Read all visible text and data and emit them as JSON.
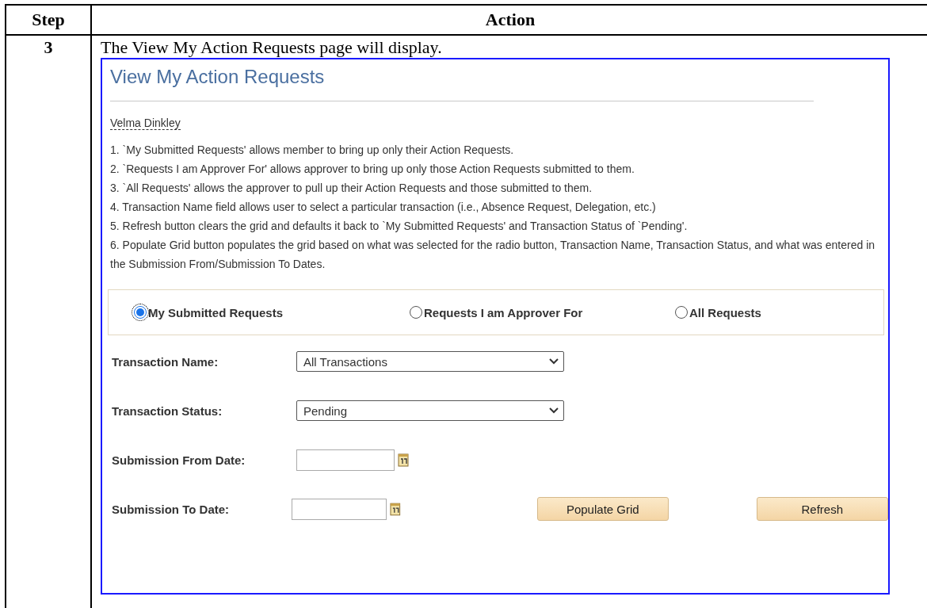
{
  "table": {
    "columns": [
      "Step",
      "Action"
    ],
    "rows": [
      {
        "step": "3",
        "instruction": "The View My Action Requests page will display.",
        "screenshot": {
          "title": "View My Action Requests",
          "user_name": "Velma Dinkley",
          "notes": [
            "1. `My Submitted Requests' allows member to bring up only their Action Requests.",
            "2. `Requests I am Approver For' allows approver to bring up only those Action Requests submitted to them.",
            "3. `All Requests' allows the approver to pull up their Action Requests and those submitted to them.",
            "4. Transaction Name field allows user to select a particular transaction (i.e., Absence Request, Delegation, etc.)",
            "5. Refresh button clears the grid and defaults it back to `My Submitted Requests' and Transaction Status of `Pending'.",
            "6. Populate Grid button populates the grid based on what was selected for the radio button, Transaction Name, Transaction Status, and what was entered in the Submission From/Submission To Dates."
          ],
          "radios": [
            {
              "label": "My Submitted Requests",
              "selected": true
            },
            {
              "label": "Requests I am Approver For",
              "selected": false
            },
            {
              "label": "All Requests",
              "selected": false
            }
          ],
          "fields": [
            {
              "kind": "select",
              "label": "Transaction Name:",
              "value": "All Transactions"
            },
            {
              "kind": "select",
              "label": "Transaction Status:",
              "value": "Pending"
            },
            {
              "kind": "date",
              "label": "Submission From Date:"
            },
            {
              "kind": "date",
              "label": "Submission To Date:"
            }
          ],
          "buttons": [
            "Populate Grid",
            "Refresh"
          ]
        }
      }
    ]
  }
}
